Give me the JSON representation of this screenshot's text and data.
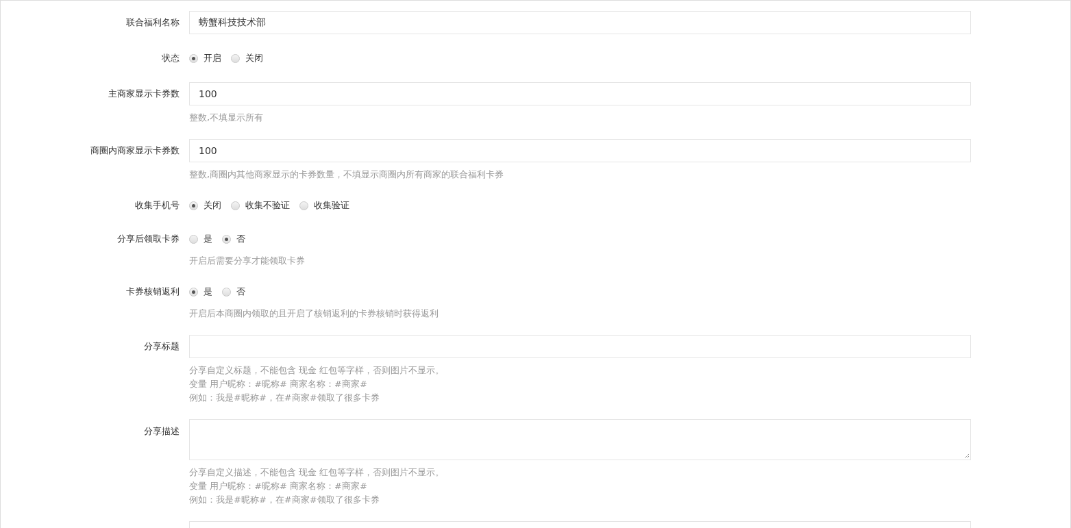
{
  "form": [
    {
      "kind": "input",
      "label": "联合福利名称",
      "value": "螃蟹科技技术部"
    },
    {
      "kind": "radio",
      "label": "状态",
      "options": [
        {
          "label": "开启",
          "selected": true
        },
        {
          "label": "关闭",
          "selected": false
        }
      ]
    },
    {
      "kind": "input",
      "label": "主商家显示卡券数",
      "value": "100",
      "hint": [
        "整数,不填显示所有"
      ]
    },
    {
      "kind": "input",
      "label": "商圈内商家显示卡券数",
      "value": "100",
      "hint": [
        "整数,商圈内其他商家显示的卡券数量，不填显示商圈内所有商家的联合福利卡券"
      ]
    },
    {
      "kind": "radio",
      "label": "收集手机号",
      "options": [
        {
          "label": "关闭",
          "selected": true
        },
        {
          "label": "收集不验证",
          "selected": false
        },
        {
          "label": "收集验证",
          "selected": false
        }
      ]
    },
    {
      "kind": "radio",
      "label": "分享后领取卡券",
      "options": [
        {
          "label": "是",
          "selected": false
        },
        {
          "label": "否",
          "selected": true
        }
      ],
      "hint": [
        "开启后需要分享才能领取卡券"
      ]
    },
    {
      "kind": "radio",
      "label": "卡券核销返利",
      "options": [
        {
          "label": "是",
          "selected": true
        },
        {
          "label": "否",
          "selected": false
        }
      ],
      "hint": [
        "开启后本商圈内领取的且开启了核销返利的卡券核销时获得返利"
      ]
    },
    {
      "kind": "input",
      "label": "分享标题",
      "hint": [
        "分享自定义标题，不能包含 现金 红包等字样，否则图片不显示。",
        "变量 用户昵称：#昵称# 商家名称：#商家#",
        "例如：我是#昵称#，在#商家#领取了很多卡券"
      ]
    },
    {
      "kind": "textarea",
      "label": "分享描述",
      "hint": [
        "分享自定义描述，不能包含 现金 红包等字样，否则图片不显示。",
        "变量 用户昵称：#昵称# 商家名称：#商家#",
        "例如：我是#昵称#，在#商家#领取了很多卡券"
      ]
    }
  ]
}
